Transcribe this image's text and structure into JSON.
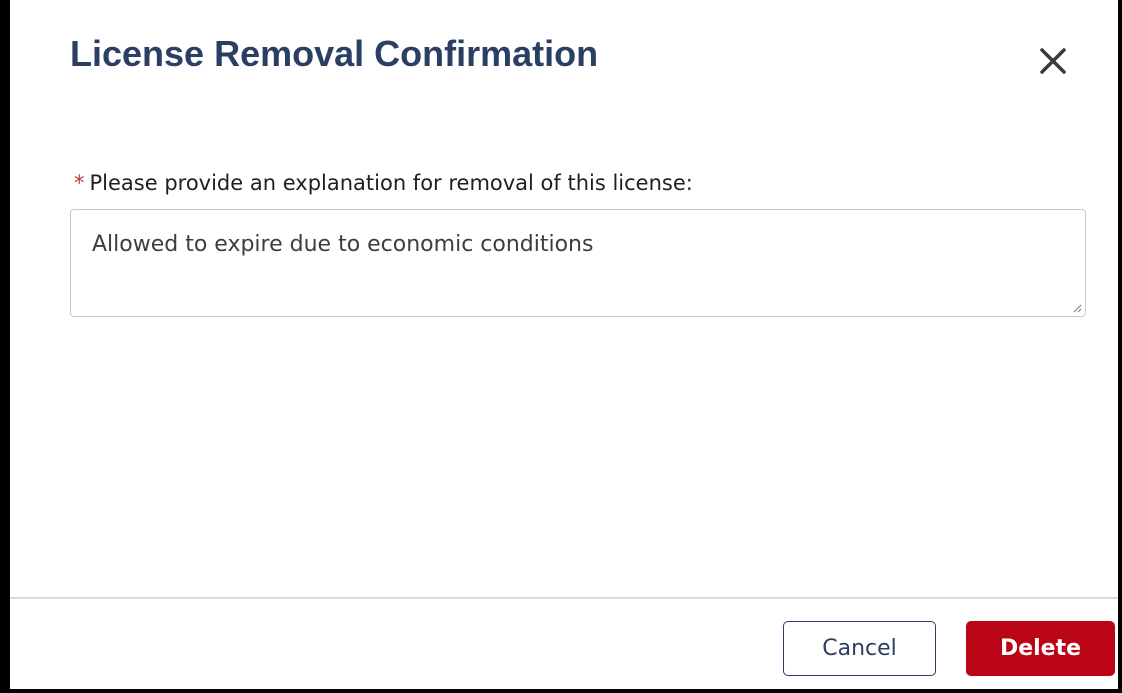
{
  "dialog": {
    "title": "License Removal Confirmation",
    "close_icon": "close-icon"
  },
  "form": {
    "required_marker": "*",
    "label": "Please provide an explanation for removal of this license:",
    "explanation_value": "Allowed to expire due to economic conditions"
  },
  "footer": {
    "cancel_label": "Cancel",
    "delete_label": "Delete"
  },
  "colors": {
    "title": "#2a3f63",
    "required": "#c23934",
    "delete_background": "#ba0517",
    "border": "#c9c9c9",
    "divider": "#dddbda"
  }
}
